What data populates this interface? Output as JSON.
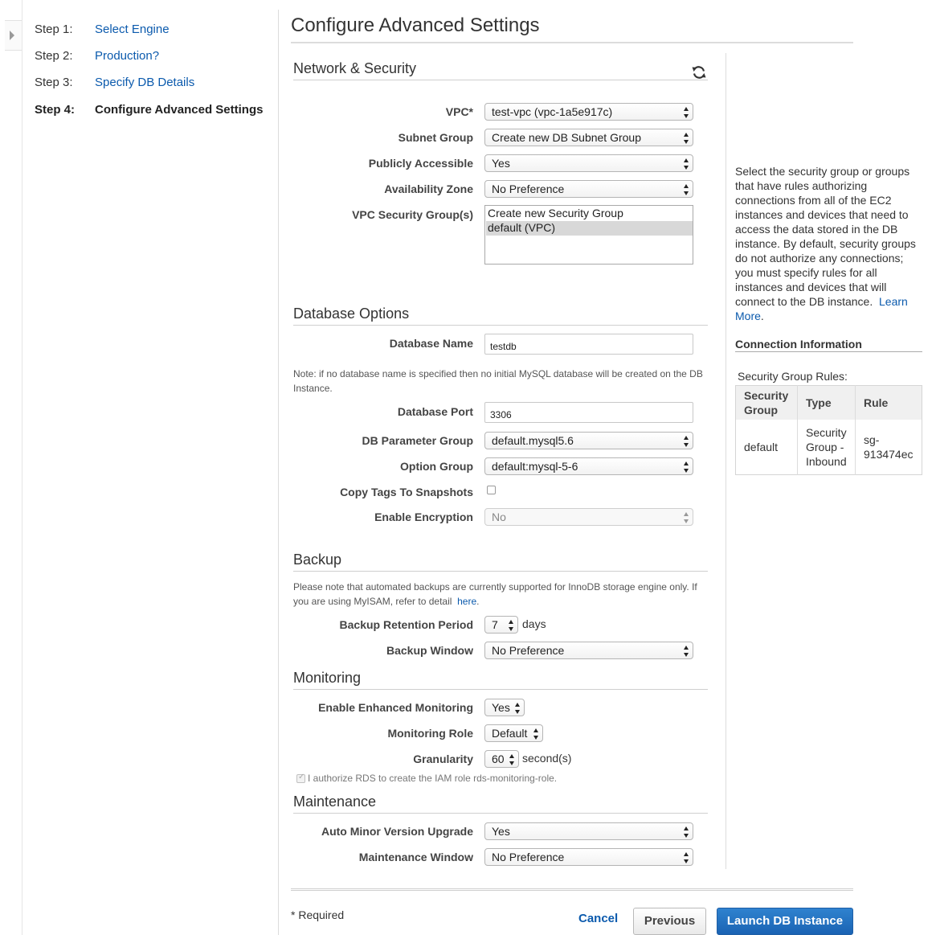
{
  "steps": [
    {
      "num": "Step 1:",
      "label": "Select Engine"
    },
    {
      "num": "Step 2:",
      "label": "Production?"
    },
    {
      "num": "Step 3:",
      "label": "Specify DB Details"
    },
    {
      "num": "Step 4:",
      "label": "Configure Advanced Settings"
    }
  ],
  "page_title": "Configure Advanced Settings",
  "network": {
    "title": "Network & Security",
    "vpc_label": "VPC*",
    "vpc_value": "test-vpc (vpc-1a5e917c)",
    "subnet_label": "Subnet Group",
    "subnet_value": "Create new DB Subnet Group",
    "public_label": "Publicly Accessible",
    "public_value": "Yes",
    "az_label": "Availability Zone",
    "az_value": "No Preference",
    "sg_label": "VPC Security Group(s)",
    "sg_options": [
      "Create new Security Group",
      "default (VPC)"
    ]
  },
  "database": {
    "title": "Database Options",
    "name_label": "Database Name",
    "name_value": "testdb",
    "note": "Note: if no database name is specified then no initial MySQL database will be created on the DB Instance.",
    "port_label": "Database Port",
    "port_value": "3306",
    "param_label": "DB Parameter Group",
    "param_value": "default.mysql5.6",
    "option_label": "Option Group",
    "option_value": "default:mysql-5-6",
    "copy_tags_label": "Copy Tags To Snapshots",
    "encryption_label": "Enable Encryption",
    "encryption_value": "No"
  },
  "backup": {
    "title": "Backup",
    "note": "Please note that automated backups are currently supported for InnoDB storage engine only. If you are using MyISAM, refer to detail",
    "note_link": "here",
    "retention_label": "Backup Retention Period",
    "retention_value": "7",
    "retention_unit": "days",
    "window_label": "Backup Window",
    "window_value": "No Preference"
  },
  "monitoring": {
    "title": "Monitoring",
    "enhanced_label": "Enable Enhanced Monitoring",
    "enhanced_value": "Yes",
    "role_label": "Monitoring Role",
    "role_value": "Default",
    "granularity_label": "Granularity",
    "granularity_value": "60",
    "granularity_unit": "second(s)",
    "authorize_text": "I authorize RDS to create the IAM role rds-monitoring-role."
  },
  "maintenance": {
    "title": "Maintenance",
    "upgrade_label": "Auto Minor Version Upgrade",
    "upgrade_value": "Yes",
    "window_label": "Maintenance Window",
    "window_value": "No Preference"
  },
  "help": {
    "text": "Select the security group or groups that have rules authorizing connections from all of the EC2 instances and devices that need to access the data stored in the DB instance. By default, security groups do not authorize any connections; you must specify rules for all instances and devices that will connect to the DB instance.",
    "learn_more": "Learn More",
    "connection_heading": "Connection Information",
    "sg_rules_title": "Security Group Rules:",
    "table_headers": [
      "Security Group",
      "Type",
      "Rule"
    ],
    "table_row": [
      "default",
      "Security Group - Inbound",
      "sg-913474ec"
    ]
  },
  "footer": {
    "required": "* Required",
    "cancel": "Cancel",
    "previous": "Previous",
    "launch": "Launch DB Instance"
  }
}
